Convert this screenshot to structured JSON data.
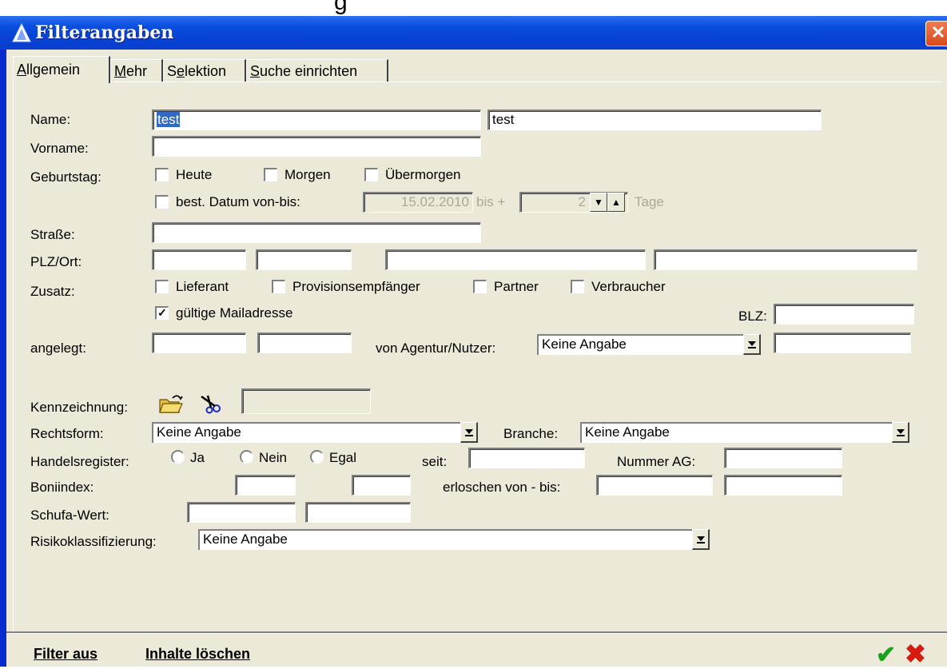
{
  "window": {
    "title": "Filterangaben",
    "close_glyph": "✕"
  },
  "tabs": [
    {
      "label": "Allgemein",
      "accel": "A",
      "rest": "llgemein"
    },
    {
      "label": "Mehr",
      "accel": "M",
      "rest": "ehr"
    },
    {
      "label": "Selektion",
      "pre": "S",
      "accel": "e",
      "rest": "lektion"
    },
    {
      "label": "Suche einrichten",
      "accel": "S",
      "rest": "uche einrichten"
    }
  ],
  "form": {
    "name_label": "Name:",
    "name_value": "test",
    "name2_value": "test",
    "vorname_label": "Vorname:",
    "geburtstag_label": "Geburtstag:",
    "heute": "Heute",
    "morgen": "Morgen",
    "uebermorgen": "Übermorgen",
    "best_datum": "best. Datum von-bis:",
    "datum_value": "15.02.2010",
    "bis_plus": "bis +",
    "tage_value": "2",
    "tage": "Tage",
    "strasse_label": "Straße:",
    "plz_label": "PLZ/Ort:",
    "zusatz_label": "Zusatz:",
    "lieferant": "Lieferant",
    "provision": "Provisionsempfänger",
    "partner": "Partner",
    "verbraucher": "Verbraucher",
    "mail": "gültige Mailadresse",
    "mail_checked": "✓",
    "blz_label": "BLZ:",
    "angelegt_label": "angelegt:",
    "agentur_label": "von Agentur/Nutzer:",
    "agentur_value": "Keine Angabe",
    "kennzeichnung_label": "Kennzeichnung:",
    "rechtsform_label": "Rechtsform:",
    "rechtsform_value": "Keine Angabe",
    "branche_label": "Branche:",
    "branche_value": "Keine Angabe",
    "handelsregister_label": "Handelsregister:",
    "ja": "Ja",
    "nein": "Nein",
    "egal": "Egal",
    "seit_label": "seit:",
    "nummer_label": "Nummer AG:",
    "boniindex_label": "Boniindex:",
    "erloschen_label": "erloschen von - bis:",
    "schufa_label": "Schufa-Wert:",
    "risiko_label": "Risikoklassifizierung:",
    "risiko_value": "Keine Angabe"
  },
  "footer": {
    "filter_aus": "Filter aus",
    "inhalte_loeschen": "Inhalte löschen",
    "ok_glyph": "✔",
    "cancel_glyph": "✖"
  },
  "icons": {
    "title": "app-triangle-icon",
    "folder": "folder-open-icon",
    "scissors": "scissors-icon"
  },
  "colors": {
    "titlebar": "#0a4fe0",
    "client": "#ece9d8",
    "ok": "#17a31a",
    "cancel": "#d81a10"
  }
}
